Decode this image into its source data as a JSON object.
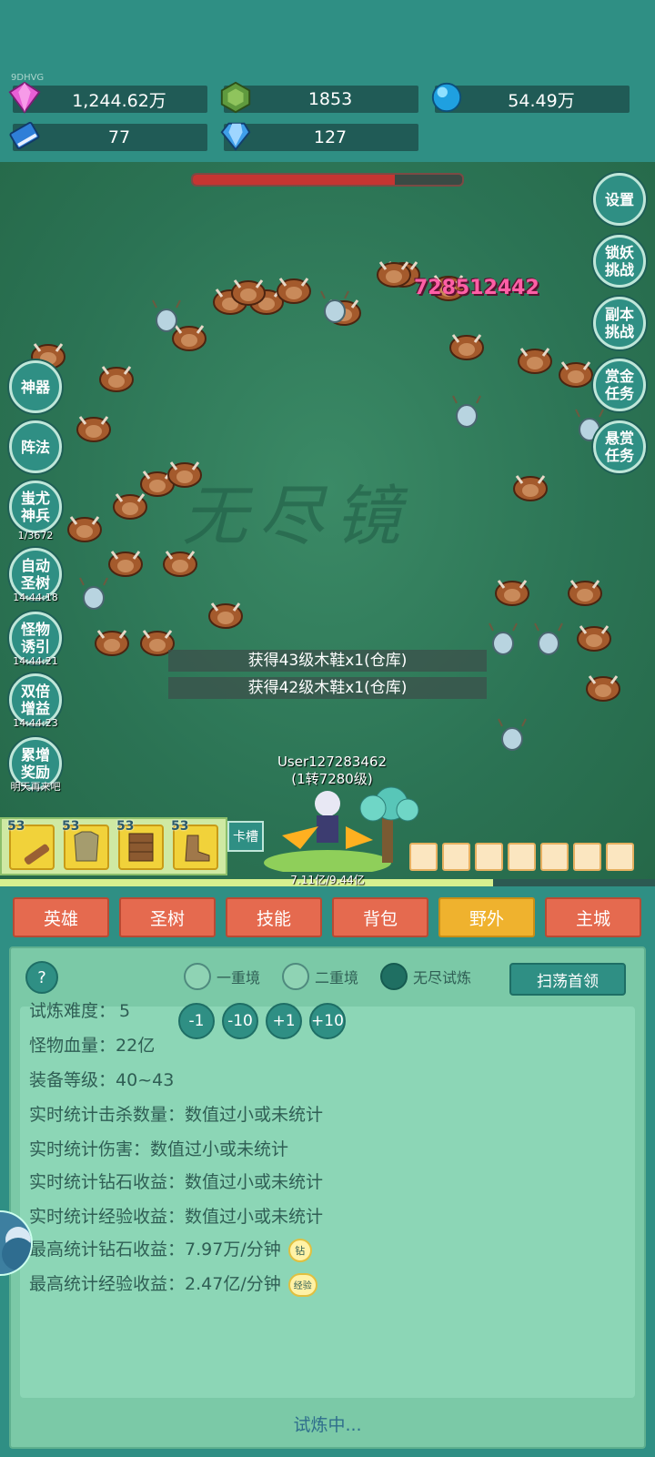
{
  "resources": {
    "watermark": "9DHVG",
    "diamond": "1,244.62万",
    "emerald": "1853",
    "orb": "54.49万",
    "book": "77",
    "crystal": "127"
  },
  "battle": {
    "boss_hp_fraction": 0.75,
    "damage_number": "728512442",
    "loot_messages": [
      "获得43级木鞋x1(仓库)",
      "获得42级木鞋x1(仓库)"
    ],
    "player_name": "User127283462",
    "player_rank": "(1转7280级)",
    "exp_text": "7.11亿/9.44亿",
    "exp_fraction": 0.753,
    "card_slot": "卡槽",
    "equip_levels": [
      "53",
      "53",
      "53",
      "53"
    ]
  },
  "left_buttons": [
    {
      "label": "神器",
      "sub": ""
    },
    {
      "label": "阵法",
      "sub": ""
    },
    {
      "label": "蚩尤\n神兵",
      "sub": "1/3672"
    },
    {
      "label": "自动\n圣树",
      "sub": "14:44:18"
    },
    {
      "label": "怪物\n诱引",
      "sub": "14:44:21"
    },
    {
      "label": "双倍\n增益",
      "sub": "14:44:23"
    },
    {
      "label": "累增\n奖励",
      "sub": "明天再来吧"
    }
  ],
  "right_buttons": [
    "设置",
    "锁妖\n挑战",
    "副本\n挑战",
    "赏金\n任务",
    "悬赏\n任务"
  ],
  "tabs": [
    "英雄",
    "圣树",
    "技能",
    "背包",
    "野外",
    "主城"
  ],
  "active_tab": "野外",
  "panel": {
    "help": "?",
    "modes": [
      "一重境",
      "二重境",
      "无尽试炼"
    ],
    "selected_mode": "无尽试炼",
    "sweep_label": "扫荡首领",
    "difficulty_label": "试炼难度：",
    "difficulty_value": "5",
    "adjust": [
      "-1",
      "-10",
      "+1",
      "+10"
    ],
    "hp_label": "怪物血量：",
    "hp_value": "22亿",
    "gear_label": "装备等级：",
    "gear_value": "40~43",
    "kills_label": "实时统计击杀数量：",
    "kills_value": "数值过小或未统计",
    "damage_label": "实时统计伤害：",
    "damage_value": "数值过小或未统计",
    "diamond_rate_label": "实时统计钻石收益：",
    "diamond_rate_value": "数值过小或未统计",
    "exp_rate_label": "实时统计经验收益：",
    "exp_rate_value": "数值过小或未统计",
    "max_diamond_label": "最高统计钻石收益：",
    "max_diamond_value": "7.97万/分钟",
    "diamond_badge": "钻",
    "max_exp_label": "最高统计经验收益：",
    "max_exp_value": "2.47亿/分钟",
    "exp_badge": "经验",
    "status": "试炼中..."
  }
}
